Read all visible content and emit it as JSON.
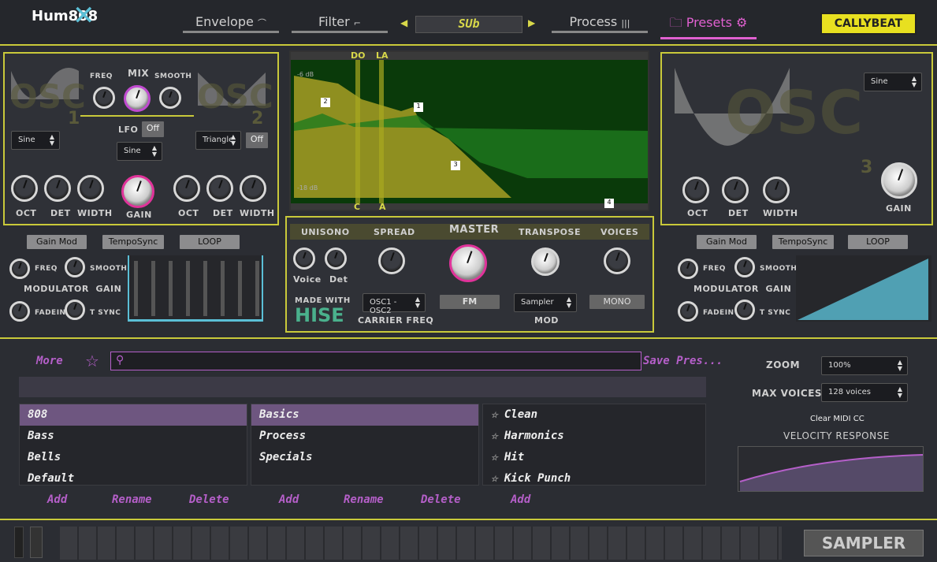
{
  "header": {
    "logo": "Hum808",
    "tabs": [
      {
        "label": "Envelope"
      },
      {
        "label": "Filter"
      },
      {
        "label": "Process"
      },
      {
        "label": "Presets"
      }
    ],
    "preset_display": "SUb",
    "brand": "CALLYBEAT"
  },
  "osc12": {
    "freq_label": "FREQ",
    "mix_label": "MIX",
    "smooth_label": "SMOOTH",
    "osc1_num": "1",
    "osc2_num": "2",
    "osc_word": "OSC",
    "osc1_wave": "Sine",
    "lfo_label": "LFO",
    "lfo_state": "Off",
    "lfo_wave": "Sine",
    "osc2_wave": "Triangle",
    "osc2_state": "Off",
    "oct": "OCT",
    "det": "DET",
    "width": "WIDTH",
    "gain": "GAIN"
  },
  "modulator": {
    "gainmod": "Gain Mod",
    "temposync": "TempoSync",
    "loop": "LOOP",
    "freq": "FREQ",
    "smooth": "SMOOTH",
    "title": "MODULATOR  GAIN",
    "fadein": "FADEIN",
    "tsync": "T SYNC",
    "steps": [
      "1",
      "2",
      "3",
      "4",
      "5",
      "6",
      "7",
      "8"
    ]
  },
  "spectrum": {
    "top_labels": [
      "DO",
      "LA"
    ],
    "bottom_labels": [
      "C",
      "A"
    ],
    "nodes": [
      "2",
      "1",
      "3",
      "4"
    ],
    "db_top": "-6 dB",
    "db_bottom": "-18 dB"
  },
  "master": {
    "unisono": "UNISONO",
    "spread": "SPREAD",
    "master": "MASTER",
    "transpose": "TRANSPOSE",
    "voices": "VOICES",
    "voice": "Voice",
    "det": "Det",
    "made_with": "MADE WITH",
    "hise": "HISE",
    "carrier_sel": "OSC1 - OSC2",
    "carrier_label": "CARRIER FREQ",
    "fm": "FM",
    "mod_sel": "Sampler",
    "mod_label": "MOD",
    "mono": "MONO"
  },
  "osc3": {
    "wave": "Sine",
    "osc_word": "OSC",
    "num": "3",
    "oct": "OCT",
    "det": "DET",
    "width": "WIDTH",
    "gain": "GAIN"
  },
  "modulator2": {
    "gainmod": "Gain Mod",
    "temposync": "TempoSync",
    "loop": "LOOP",
    "freq": "FREQ",
    "smooth": "SMOOTH",
    "title": "MODULATOR  GAIN",
    "fadein": "FADEIN",
    "tsync": "T SYNC",
    "steps": [
      "1",
      "2",
      "3",
      "4",
      "5",
      "6",
      "7",
      "8"
    ]
  },
  "browser": {
    "more": "More",
    "save": "Save Pres...",
    "search_placeholder": "",
    "col1": [
      "808",
      "Bass",
      "Bells",
      "Default"
    ],
    "col2": [
      "Basics",
      "Process",
      "Specials"
    ],
    "col3": [
      "Clean",
      "Harmonics",
      "Hit",
      "Kick Punch"
    ],
    "add": "Add",
    "rename": "Rename",
    "delete": "Delete"
  },
  "settings": {
    "zoom_label": "ZOOM",
    "zoom_value": "100%",
    "voices_label": "MAX VOICES",
    "voices_value": "128 voices",
    "clear_midi": "Clear MIDI CC",
    "velocity": "VELOCITY RESPONSE"
  },
  "footer": {
    "sampler": "SAMPLER"
  },
  "colors": {
    "accent": "#c9c93a",
    "pink": "#e0339a",
    "purple": "#b55fc9",
    "teal": "#5bbfd6"
  }
}
